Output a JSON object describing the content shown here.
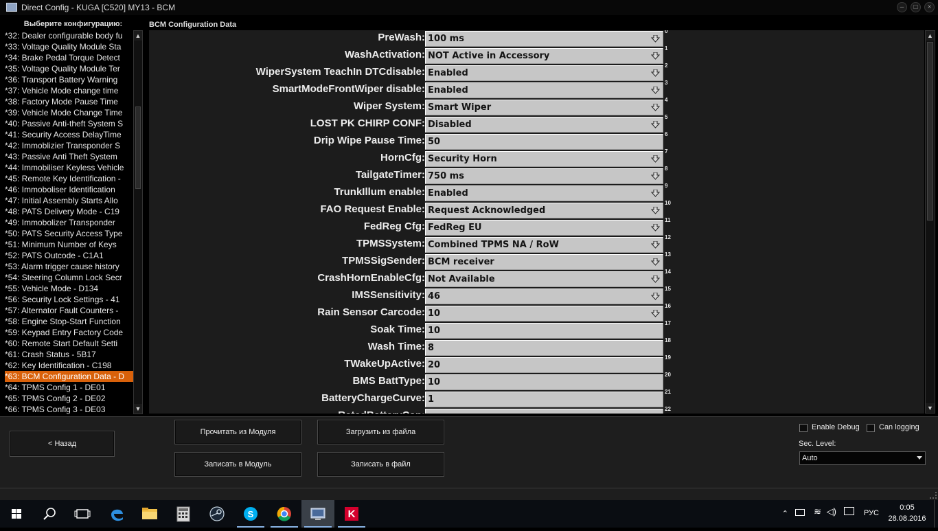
{
  "window": {
    "title": "Direct Config - KUGA [C520] MY13 - BCM",
    "controls": [
      "minimize-icon",
      "maximize-icon",
      "close-icon"
    ]
  },
  "left_panel": {
    "header": "Выберите конфигурацию:",
    "items": [
      "*32: Dealer configurable body fu",
      "*33: Voltage Quality Module Sta",
      "*34: Brake Pedal Torque Detect",
      "*35: Voltage Quality Module Ter",
      "*36: Transport Battery Warning",
      "*37: Vehicle Mode change time",
      "*38: Factory Mode Pause Time",
      "*39: Vehicle Mode Change Time",
      "*40: Passive Anti-theft System S",
      "*41: Security Access DelayTime",
      "*42: Immoblizier Transponder S",
      "*43: Passive Anti Theft System",
      "*44: Immobiliser Keyless Vehicle",
      "*45: Remote Key Identification -",
      "*46: Immoboliser Identification",
      "*47: Initial Assembly Starts Allo",
      "*48: PATS Delivery Mode - C19",
      "*49: Immobolizer Transponder",
      "*50: PATS Security Access Type",
      "*51: Minimum Number of Keys",
      "*52: PATS Outcode - C1A1",
      "*53: Alarm trigger cause history",
      "*54: Steering Column Lock Secr",
      "*55: Vehicle Mode - D134",
      "*56: Security Lock Settings - 41",
      "*57: Alternator Fault Counters -",
      "*58: Engine Stop-Start Function",
      "*59: Keypad Entry Factory Code",
      "*60: Remote Start Default Setti",
      "*61: Crash Status - 5B17",
      "*62: Key Identification - C198",
      "*63: BCM Configuration Data - D",
      "*64: TPMS Config 1 - DE01",
      "*65: TPMS Config 2 - DE02",
      "*66: TPMS Config 3 - DE03"
    ],
    "selected_index": 31
  },
  "main_panel": {
    "header": "BCM Configuration Data",
    "rows": [
      {
        "label": "PreWash:",
        "value": "100 ms",
        "dropdown": true,
        "index": "0"
      },
      {
        "label": "WashActivation:",
        "value": "NOT Active in Accessory",
        "dropdown": true,
        "index": "1"
      },
      {
        "label": "WiperSystem TeachIn DTCdisable:",
        "value": "Enabled",
        "dropdown": true,
        "index": "2"
      },
      {
        "label": "SmartModeFrontWiper disable:",
        "value": "Enabled",
        "dropdown": true,
        "index": "3"
      },
      {
        "label": "Wiper System:",
        "value": "Smart Wiper",
        "dropdown": true,
        "index": "4"
      },
      {
        "label": "LOST PK CHIRP CONF:",
        "value": "Disabled",
        "dropdown": true,
        "index": "5"
      },
      {
        "label": "Drip Wipe Pause Time:",
        "value": "50",
        "dropdown": false,
        "index": "6"
      },
      {
        "label": "HornCfg:",
        "value": "Security Horn",
        "dropdown": true,
        "index": "7"
      },
      {
        "label": "TailgateTimer:",
        "value": "750 ms",
        "dropdown": true,
        "index": "8"
      },
      {
        "label": "TrunkIllum enable:",
        "value": "Enabled",
        "dropdown": true,
        "index": "9"
      },
      {
        "label": "FAO Request Enable:",
        "value": "Request Acknowledged",
        "dropdown": true,
        "index": "10"
      },
      {
        "label": "FedReg Cfg:",
        "value": "FedReg EU",
        "dropdown": true,
        "index": "11"
      },
      {
        "label": "TPMSSystem:",
        "value": "Combined TPMS NA / RoW",
        "dropdown": true,
        "index": "12"
      },
      {
        "label": "TPMSSigSender:",
        "value": "BCM receiver",
        "dropdown": true,
        "index": "13"
      },
      {
        "label": "CrashHornEnableCfg:",
        "value": "Not Available",
        "dropdown": true,
        "index": "14"
      },
      {
        "label": "IMSSensitivity:",
        "value": "46",
        "dropdown": true,
        "index": "15"
      },
      {
        "label": "Rain Sensor Carcode:",
        "value": "10",
        "dropdown": true,
        "index": "16"
      },
      {
        "label": "Soak Time:",
        "value": "10",
        "dropdown": false,
        "index": "17"
      },
      {
        "label": "Wash Time:",
        "value": "8",
        "dropdown": false,
        "index": "18"
      },
      {
        "label": "TWakeUpActive:",
        "value": "20",
        "dropdown": false,
        "index": "19"
      },
      {
        "label": "BMS BattType:",
        "value": "10",
        "dropdown": false,
        "index": "20"
      },
      {
        "label": "BatteryChargeCurve:",
        "value": "1",
        "dropdown": false,
        "index": "21"
      },
      {
        "label": "RatedBatteryCap:",
        "value": "",
        "dropdown": false,
        "index": "22"
      }
    ]
  },
  "bottom": {
    "back_button": "< Назад",
    "read_module_button": "Прочитать из Модуля",
    "load_file_button": "Загрузить из файла",
    "write_module_button": "Записать в Модуль",
    "write_file_button": "Записать в файл",
    "enable_debug_label": "Enable Debug",
    "enable_debug_checked": false,
    "can_logging_label": "Can logging",
    "can_logging_checked": false,
    "sec_level_label": "Sec. Level:",
    "sec_level_value": "Auto"
  },
  "taskbar": {
    "apps": [
      "start-icon",
      "search-icon",
      "task-view-icon",
      "edge-icon",
      "file-explorer-icon",
      "calculator-icon",
      "steam-icon",
      "skype-icon",
      "chrome-icon",
      "direct-config-icon",
      "kaspersky-icon"
    ],
    "active_app": "direct-config-icon",
    "language": "РУС",
    "time": "0:05",
    "date": "28.08.2016"
  },
  "colors": {
    "selection": "#d9610a",
    "field_bg": "#c6c6c6",
    "panel_bg": "#1c1c1c"
  }
}
